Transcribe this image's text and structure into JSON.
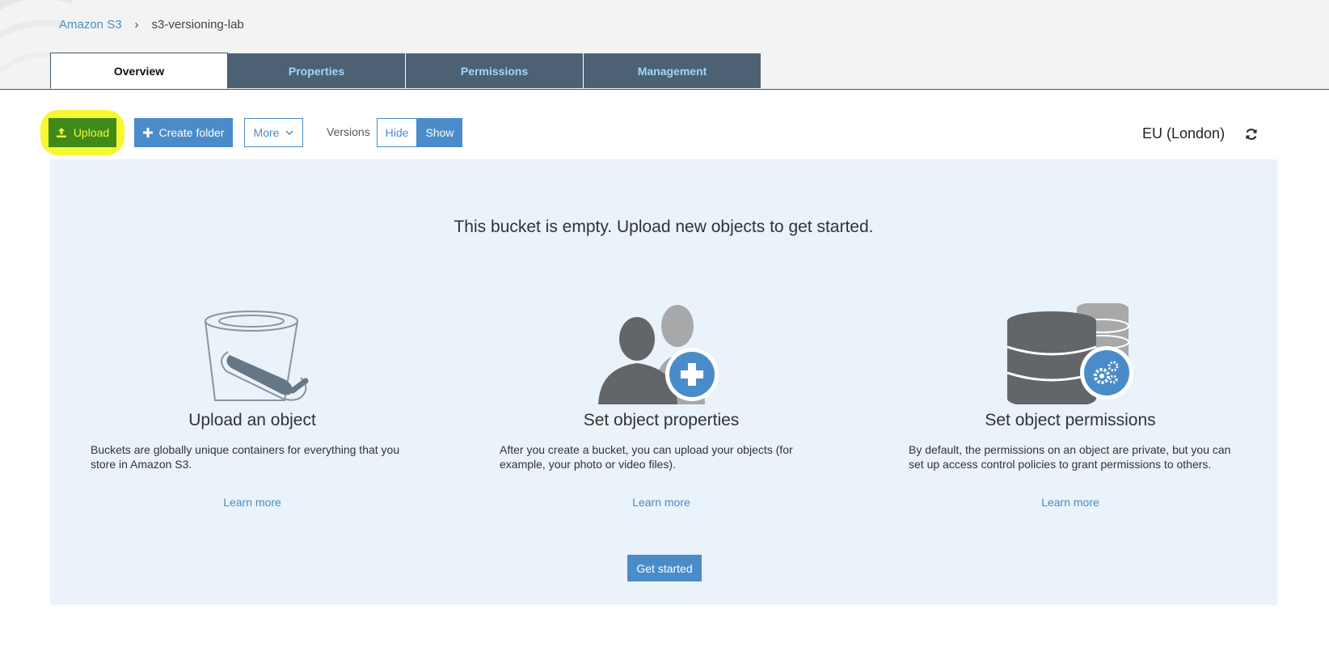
{
  "breadcrumb": {
    "root": "Amazon S3",
    "separator": "›",
    "current": "s3-versioning-lab"
  },
  "tabs": [
    {
      "label": "Overview",
      "active": true
    },
    {
      "label": "Properties",
      "active": false
    },
    {
      "label": "Permissions",
      "active": false
    },
    {
      "label": "Management",
      "active": false
    }
  ],
  "toolbar": {
    "upload_label": "Upload",
    "upload_icon": "upload-icon",
    "create_folder_label": "Create folder",
    "create_folder_icon": "plus-icon",
    "more_label": "More",
    "more_icon": "chevron-down-icon",
    "versions_label": "Versions",
    "hide_label": "Hide",
    "show_label": "Show",
    "highlight_color": "#f7f733"
  },
  "region": {
    "label": "EU (London)",
    "refresh_icon": "refresh-icon"
  },
  "empty_state": {
    "title": "This bucket is empty. Upload new objects to get started.",
    "cards": [
      {
        "icon": "bucket-icon",
        "heading": "Upload an object",
        "description": "Buckets are globally unique containers for everything that you store in Amazon S3.",
        "learn_more": "Learn more"
      },
      {
        "icon": "users-add-icon",
        "heading": "Set object properties",
        "description": "After you create a bucket, you can upload your objects (for example, your photo or video files).",
        "learn_more": "Learn more"
      },
      {
        "icon": "database-settings-icon",
        "heading": "Set object permissions",
        "description": "By default, the permissions on an object are private, but you can set up access control policies to grant permissions to others.",
        "learn_more": "Learn more"
      }
    ],
    "get_started_label": "Get started"
  },
  "colors": {
    "tab_bg": "#4c6173",
    "tab_text": "#9fd8ff",
    "primary": "#4a8cc9",
    "panel_bg": "#eaf2fa",
    "link": "#4a8cc2"
  }
}
